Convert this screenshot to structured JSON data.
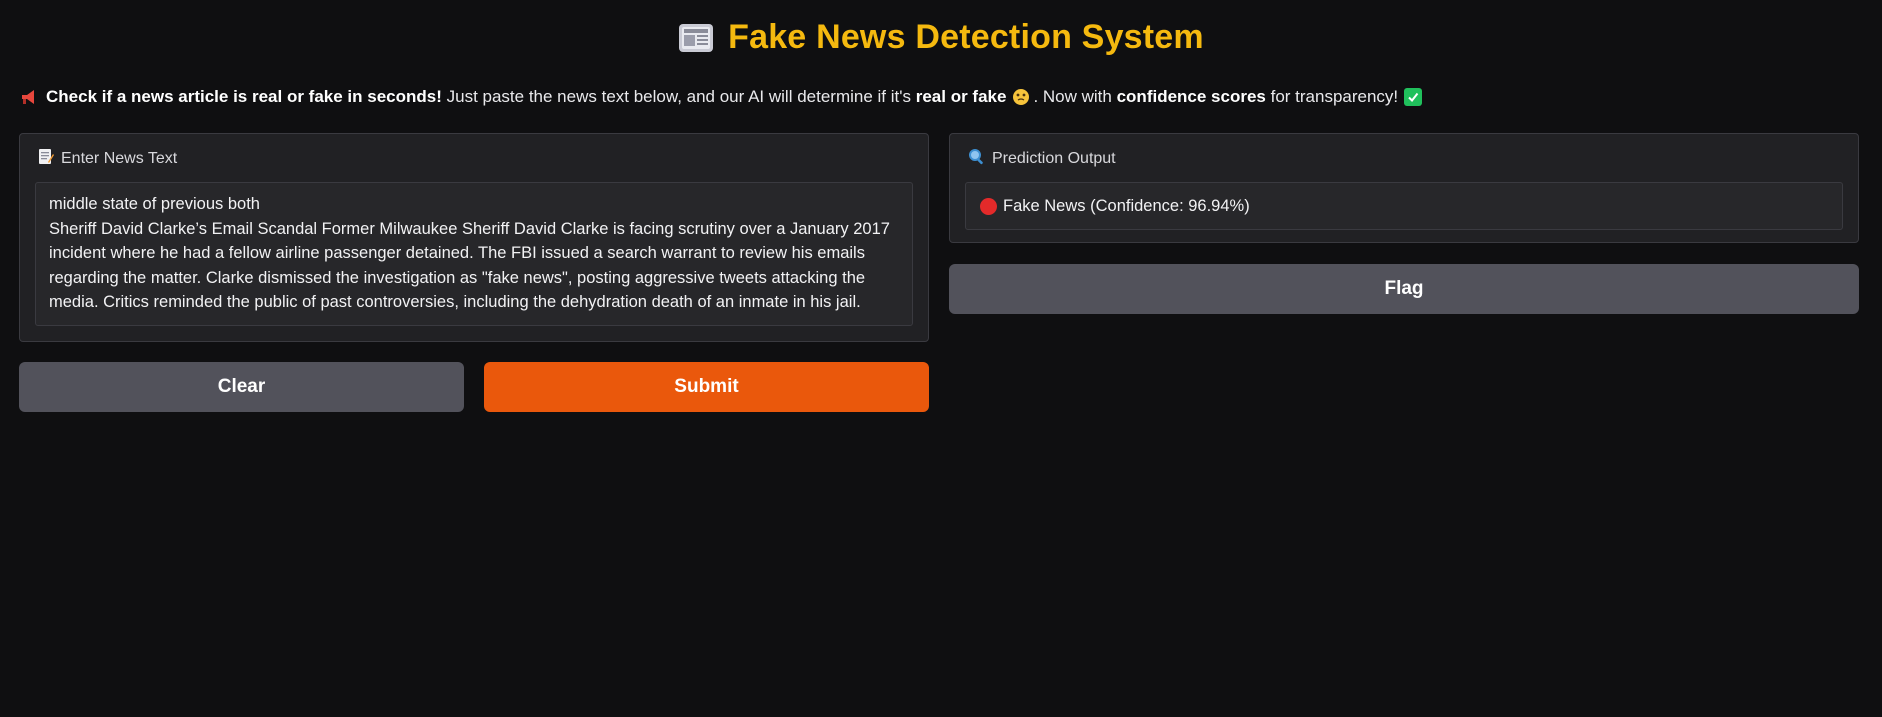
{
  "header": {
    "title": "Fake News Detection System",
    "icon": "newspaper-icon"
  },
  "description": {
    "lead_bold": "Check if a news article is real or fake in seconds!",
    "text_1": " Just paste the news text below, and our AI will determine if it's ",
    "bold_2": "real or fake",
    "text_3": ". Now with ",
    "bold_4": "confidence scores",
    "text_5": " for transparency!",
    "icons": [
      "megaphone-icon",
      "thinking-face-icon",
      "check-mark-icon"
    ]
  },
  "input_panel": {
    "label": "Enter News Text",
    "icon": "memo-icon",
    "value": "middle state of previous both\nSheriff David Clarke’s Email Scandal Former Milwaukee Sheriff David Clarke is facing scrutiny over a January 2017 incident where he had a fellow airline passenger detained. The FBI issued a search warrant to review his emails regarding the matter. Clarke dismissed the investigation as \"fake news\", posting aggressive tweets attacking the media. Critics reminded the public of past controversies, including the dehydration death of an inmate in his jail."
  },
  "output_panel": {
    "label": "Prediction Output",
    "icon": "magnifier-icon",
    "result": "Fake News (Confidence: 96.94%)",
    "result_icon": "red-circle-icon"
  },
  "buttons": {
    "clear": "Clear",
    "submit": "Submit",
    "flag": "Flag"
  },
  "colors": {
    "background": "#0f0f11",
    "title": "#f5b90f",
    "submit": "#ea580c",
    "secondary_button": "#52525b",
    "panel": "#212124",
    "fake_indicator": "#e42a2a",
    "check": "#20c05c"
  }
}
